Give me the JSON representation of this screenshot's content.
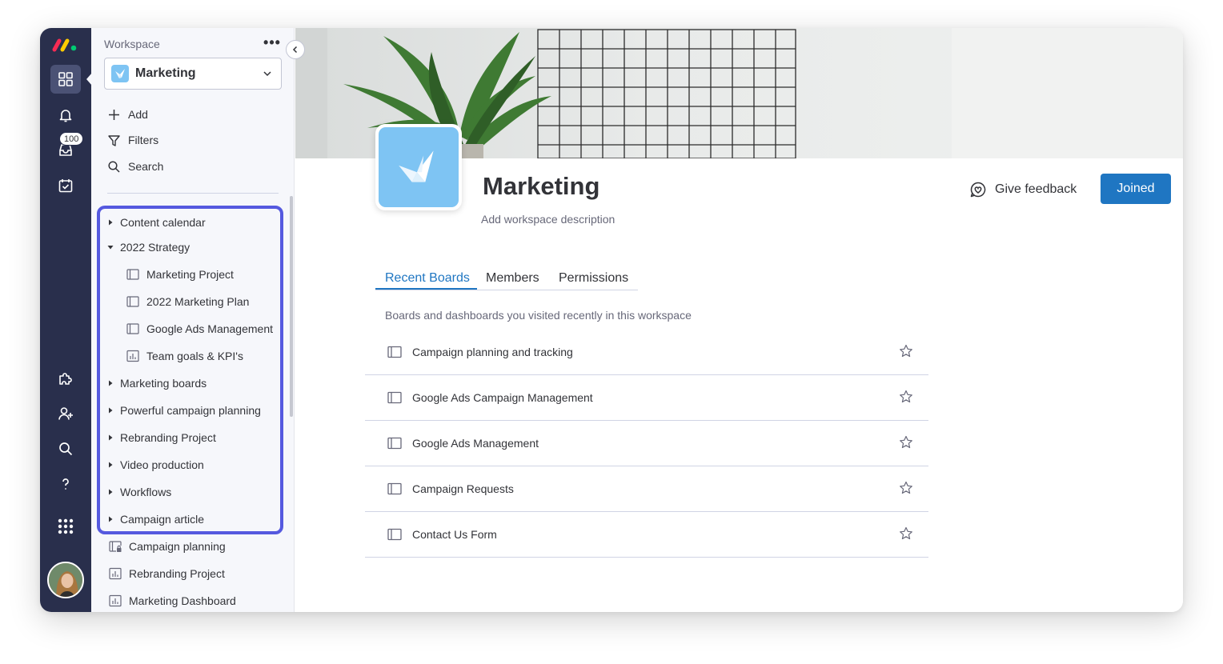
{
  "rail": {
    "inbox_badge": "100"
  },
  "sidebar": {
    "workspace_label": "Workspace",
    "more_label": "•••",
    "workspace_name": "Marketing",
    "actions": {
      "add": "Add",
      "filters": "Filters",
      "search": "Search"
    },
    "tree": [
      {
        "label": "Content calendar",
        "type": "folder",
        "expanded": false
      },
      {
        "label": "2022 Strategy",
        "type": "folder",
        "expanded": true
      },
      {
        "label": "Marketing Project",
        "type": "board"
      },
      {
        "label": "2022 Marketing Plan",
        "type": "board"
      },
      {
        "label": "Google Ads Management",
        "type": "board"
      },
      {
        "label": "Team goals & KPI's",
        "type": "dashboard"
      },
      {
        "label": "Marketing boards",
        "type": "folder",
        "expanded": false
      },
      {
        "label": "Powerful campaign planning",
        "type": "folder",
        "expanded": false
      },
      {
        "label": "Rebranding Project",
        "type": "folder",
        "expanded": false
      },
      {
        "label": "Video production",
        "type": "folder",
        "expanded": false
      },
      {
        "label": "Workflows",
        "type": "folder",
        "expanded": false
      },
      {
        "label": "Campaign article",
        "type": "folder",
        "expanded": false
      }
    ],
    "loose_items": [
      {
        "label": "Campaign planning",
        "type": "private-board"
      },
      {
        "label": "Rebranding Project",
        "type": "dashboard"
      },
      {
        "label": "Marketing Dashboard",
        "type": "dashboard"
      }
    ]
  },
  "main": {
    "title": "Marketing",
    "description": "Add workspace description",
    "feedback_label": "Give feedback",
    "joined_label": "Joined",
    "tabs": [
      "Recent Boards",
      "Members",
      "Permissions"
    ],
    "active_tab": "Recent Boards",
    "boards_subtitle": "Boards and dashboards you visited recently in this workspace",
    "recent_boards": [
      "Campaign planning and tracking",
      "Google Ads Campaign Management",
      "Google Ads Management",
      "Campaign Requests",
      "Contact Us Form"
    ]
  },
  "colors": {
    "rail_bg": "#292f4c",
    "accent": "#1f76c2",
    "highlight": "#5559df",
    "workspace_logo": "#7ec4f3"
  }
}
